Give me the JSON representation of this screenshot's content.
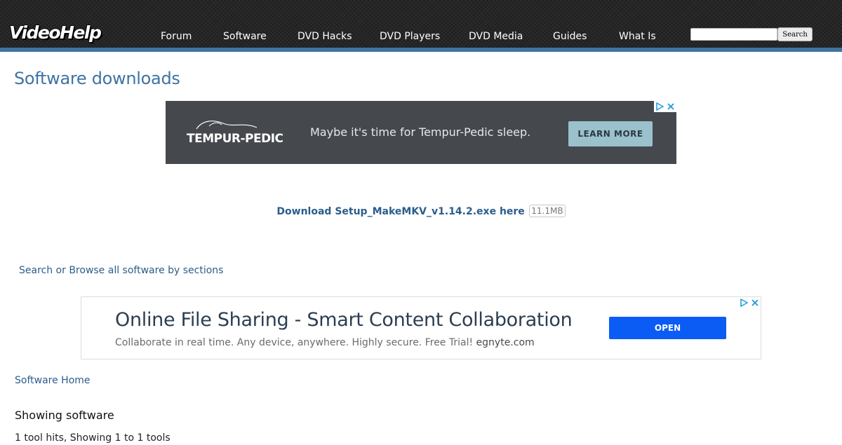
{
  "header": {
    "logo_text": "VideoHelp",
    "nav": [
      {
        "label": "Forum"
      },
      {
        "label": "Software"
      },
      {
        "label": "DVD Hacks"
      },
      {
        "label": "DVD Players"
      },
      {
        "label": "DVD Media"
      },
      {
        "label": "Guides"
      },
      {
        "label": "What Is"
      }
    ],
    "search": {
      "value": "",
      "button_label": "Search"
    },
    "stripe_color": "#3f73a3"
  },
  "page": {
    "title": "Software downloads"
  },
  "ad_top": {
    "brand": "TEMPUR-PEDIC",
    "text": "Maybe it's time for Tempur-Pedic sleep.",
    "cta": "LEARN MORE",
    "choice_icons": [
      "adchoices-icon",
      "close-icon"
    ],
    "bg_color": "#45484d",
    "cta_color": "#9bc1cc"
  },
  "download": {
    "link_text": "Download Setup_MakeMKV_v1.14.2.exe here",
    "size": "11.1MB"
  },
  "browse": {
    "link_text": "Search or Browse all software by sections"
  },
  "ad_bottom": {
    "title": "Online File Sharing - Smart Content Collaboration",
    "subtitle": "Collaborate in real time. Any device, anywhere. Highly secure. Free Trial!",
    "domain": "egnyte.com",
    "cta": "OPEN",
    "choice_icons": [
      "adchoices-icon",
      "close-icon"
    ],
    "cta_color": "#0b5cf5"
  },
  "breadcrumb": {
    "home_link": "Software Home"
  },
  "results": {
    "heading": "Showing software",
    "hits_text": "1 tool hits, Showing 1 to 1 tools"
  }
}
